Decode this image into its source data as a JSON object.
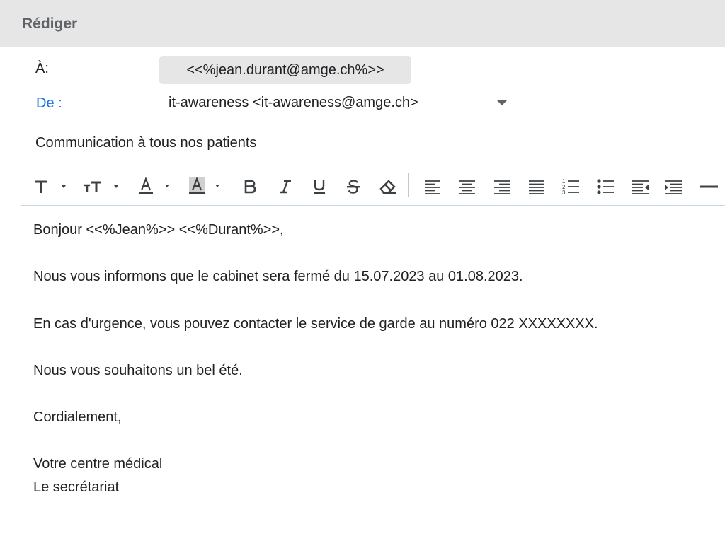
{
  "header": {
    "title": "Rédiger"
  },
  "fields": {
    "to_label": "À:",
    "to_value": "<<%jean.durant@amge.ch%>>",
    "from_label": "De :",
    "from_value": "it-awareness <it-awareness@amge.ch>",
    "subject": "Communication à tous nos patients"
  },
  "toolbar": {
    "icons": [
      "text-style-icon",
      "font-size-icon",
      "text-color-icon",
      "highlight-color-icon",
      "bold-icon",
      "italic-icon",
      "underline-icon",
      "strikethrough-icon",
      "clear-formatting-icon",
      "align-left-icon",
      "align-center-icon",
      "align-right-icon",
      "justify-icon",
      "numbered-list-icon",
      "bulleted-list-icon",
      "decrease-indent-icon",
      "increase-indent-icon",
      "horizontal-rule-icon"
    ],
    "bold_glyph": "B",
    "italic_glyph": "I",
    "underline_glyph": "U",
    "strike_glyph": "S",
    "text_glyph": "T",
    "color_glyph": "A",
    "size_glyph": "тT"
  },
  "body": {
    "greeting": "Bonjour <<%Jean%>> <<%Durant%>>,",
    "paragraph1": "Nous vous informons que le cabinet sera fermé du 15.07.2023 au 01.08.2023.",
    "paragraph2": "En cas d'urgence, vous pouvez contacter le service de garde au numéro 022 XXXXXXXX.",
    "paragraph3": "Nous vous souhaitons un bel été.",
    "closing": "Cordialement,",
    "signature_line1": "Votre centre médical",
    "signature_line2": "Le secrétariat"
  },
  "colors": {
    "header_bg": "#e6e6e6",
    "from_label": "#1a73e8",
    "icon": "#3c4043"
  }
}
